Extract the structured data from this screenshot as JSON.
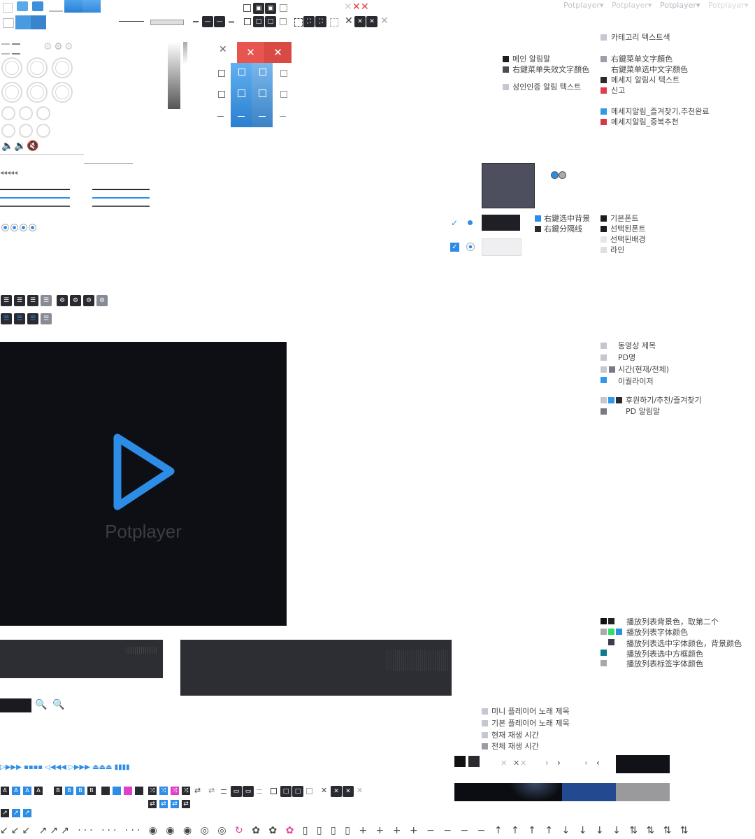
{
  "brand": "Potplayer",
  "top_menus": [
    "Potplayer",
    "Potplayer",
    "Potplayer",
    "Potplayer"
  ],
  "menu_arrow": "▾",
  "video_brand": "Potplayer",
  "legend_top": {
    "category_text": "카테고리 텍스트색",
    "main_alert": "메인 알림말",
    "ctx_disabled": "右鍵菜单失效文字顏色",
    "adult_alert": "성인인증 알림 텍스트",
    "ctx_text": "右鍵菜单文字顏色",
    "ctx_selected_text": "右鍵菜单选中文字顏色",
    "msg_alert_text": "메세지 알림시 텍스트",
    "report": "신고",
    "msg_fav_done": "메세지알림_즐겨찾기,추천완료",
    "msg_dup_reco": "메세지알림_중복추천"
  },
  "legend_mid": {
    "ctx_selected_bg": "右鍵选中背景",
    "ctx_separator": "右鍵分隔线",
    "base_font": "기본폰트",
    "selected_font": "선택된폰트",
    "selected_bg": "선택된배경",
    "line": "라인"
  },
  "legend_video": {
    "video_title": "동영상 제목",
    "pd_name": "PD명",
    "time": "시간(현재/전체)",
    "equalizer": "이퀄라이저",
    "sponsor": "후원하기/추천/즐겨찾기",
    "pd_alert": "PD 알림말"
  },
  "legend_playlist": {
    "bg": "播放列表背景色，取第二个",
    "font": "播放列表字体颜色",
    "selected_font": "播放列表选中字体颜色，背景颜色",
    "selected_border": "播放列表选中方框颜色",
    "tag_font": "播放列表标签字体颜色"
  },
  "legend_mini": {
    "mini_title": "미니 플레이어 노래 제목",
    "base_title": "기본 플레이어 노래 제목",
    "current_time": "현재 재생 시간",
    "total_time": "전체 재생 시간"
  },
  "letters": {
    "a": "A",
    "b": "B"
  },
  "colors": {
    "dark": "#0e0f14",
    "panel": "#2d2e33",
    "blue": "#2d8de6",
    "red": "#e84c4c",
    "magenta": "#e040a0",
    "grey": "#c5c7d2",
    "slate": "#4d4f5e"
  },
  "icons": [
    "camera-icon",
    "pin-icon",
    "minimize-icon",
    "maximize-icon",
    "restore-icon",
    "close-icon",
    "settings-icon",
    "play-icon",
    "pause-icon",
    "volume-icon",
    "mute-icon",
    "search-icon",
    "shuffle-icon",
    "repeat-icon"
  ]
}
